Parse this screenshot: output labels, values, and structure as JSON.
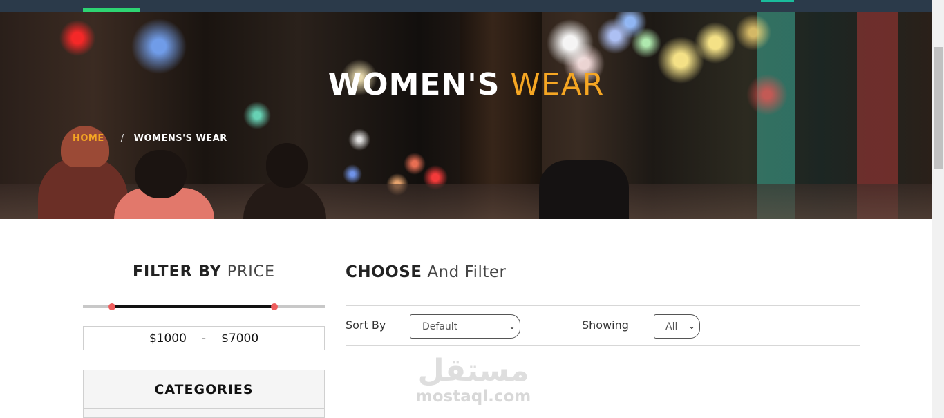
{
  "hero": {
    "title_bold": "WOMEN'S",
    "title_light": "WEAR"
  },
  "breadcrumb": {
    "home": "HOME",
    "separator": "/",
    "current": "WOMENS'S WEAR"
  },
  "sidebar": {
    "filter_title_bold": "FILTER BY",
    "filter_title_light": "PRICE",
    "price_range": {
      "min": "$1000",
      "separator": "-",
      "max": "$7000",
      "selected_low_fraction": 0.12,
      "selected_high_fraction": 0.79
    },
    "categories_title": "CATEGORIES"
  },
  "main": {
    "title_bold": "CHOOSE",
    "title_light": "And Filter",
    "sort": {
      "label": "Sort By",
      "selected": "Default"
    },
    "showing": {
      "label": "Showing",
      "selected": "All"
    }
  },
  "watermark": {
    "arabic": "مستقل",
    "latin": "mostaql.com"
  },
  "colors": {
    "accent": "#f5a623",
    "nav_bg": "#2b3a4a",
    "nav_active": "#2ed573",
    "slider_handle": "#ef5d5d"
  },
  "icons": {
    "select_chevron": "chevron-down-icon"
  }
}
